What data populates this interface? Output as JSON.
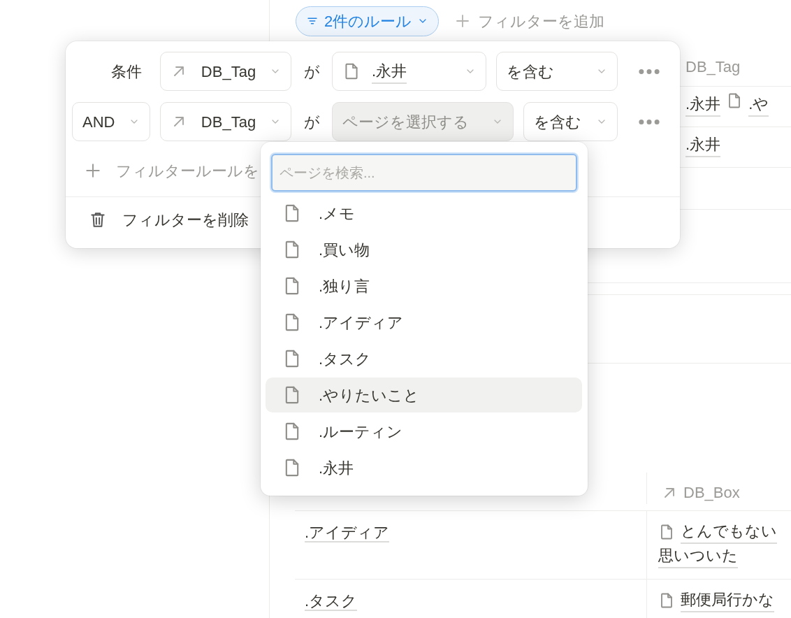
{
  "toolbar": {
    "filter_chip": {
      "label": "2件のルール",
      "active": true
    },
    "add_filter": "フィルターを追加"
  },
  "table_top": {
    "columns": [
      "DB_Tag"
    ],
    "rows": [
      {
        "tags": [
          {
            "text": ".永井",
            "icon": false
          },
          {
            "text": ".や",
            "icon": true
          }
        ]
      },
      {
        "tags": [
          {
            "text": ".永井",
            "icon": false
          }
        ]
      }
    ]
  },
  "filter_popover": {
    "rules": [
      {
        "conjunction": "条件",
        "conjunction_dropdown": false,
        "property": "DB_Tag",
        "verb": "が",
        "value": ".永井",
        "value_open": false,
        "operator": "を含む"
      },
      {
        "conjunction": "AND",
        "conjunction_dropdown": true,
        "property": "DB_Tag",
        "verb": "が",
        "value_placeholder": "ページを選択する",
        "value_open": true,
        "operator": "を含む"
      }
    ],
    "add_rule": "フィルタールールを",
    "delete": "フィルターを削除"
  },
  "page_picker": {
    "search": {
      "placeholder": "ページを検索..."
    },
    "items": [
      {
        "label": ".メモ",
        "highlighted": false
      },
      {
        "label": ".買い物",
        "highlighted": false
      },
      {
        "label": ".独り言",
        "highlighted": false
      },
      {
        "label": ".アイディア",
        "highlighted": false
      },
      {
        "label": ".タスク",
        "highlighted": false
      },
      {
        "label": ".やりたいこと",
        "highlighted": true
      },
      {
        "label": ".ルーティン",
        "highlighted": false
      },
      {
        "label": ".永井",
        "highlighted": false
      }
    ]
  },
  "table_bottom": {
    "columns": [
      "DB_Box"
    ],
    "rows": [
      {
        "name": ".アイディア",
        "box_lines": [
          "とんでもない",
          "思いついた"
        ]
      },
      {
        "name": ".タスク",
        "box_lines": [
          "郵便局行かな"
        ]
      }
    ]
  }
}
